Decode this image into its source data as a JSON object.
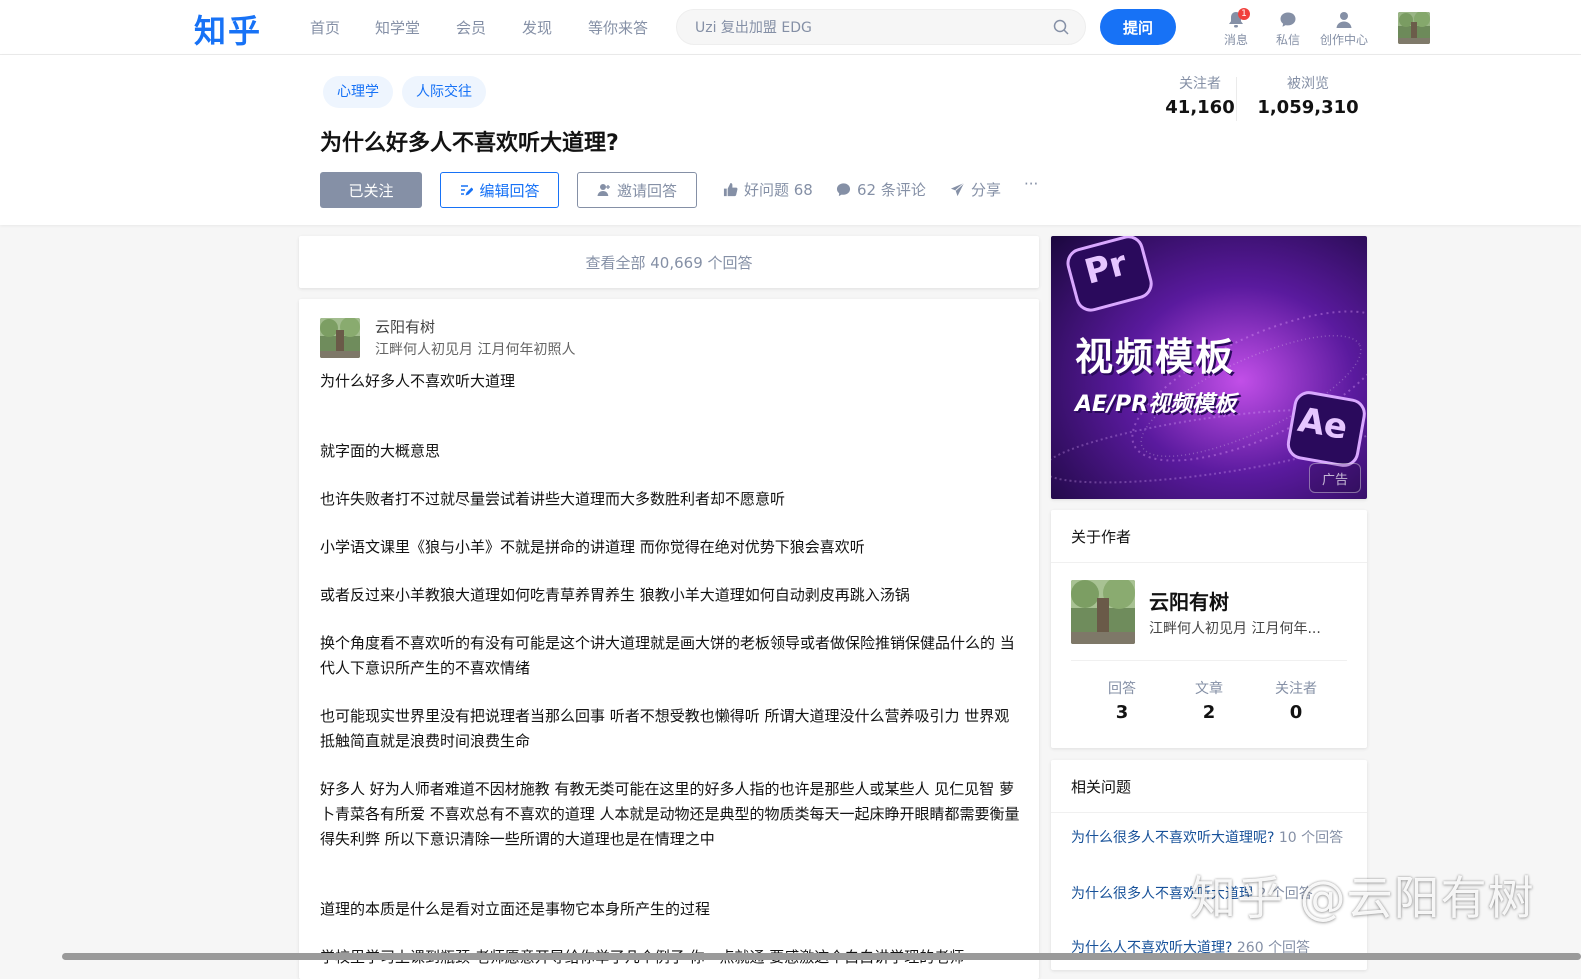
{
  "topbar": {
    "logo": "知乎",
    "nav": [
      "首页",
      "知学堂",
      "会员",
      "发现",
      "等你来答"
    ],
    "search_placeholder": "Uzi 复出加盟 EDG",
    "ask_label": "提问",
    "icons": [
      {
        "label": "消息",
        "icon": "bell-icon",
        "badge": "1"
      },
      {
        "label": "私信",
        "icon": "chat-icon"
      },
      {
        "label": "创作中心",
        "icon": "creator-icon"
      }
    ]
  },
  "question": {
    "tags": [
      "心理学",
      "人际交往"
    ],
    "title": "为什么好多人不喜欢听大道理?",
    "followed_label": "已关注",
    "edit_label": "编辑回答",
    "invite_label": "邀请回答",
    "good_question": "好问题 68",
    "comments": "62 条评论",
    "share": "分享",
    "more": "···",
    "followers_label": "关注者",
    "followers": "41,160",
    "views_label": "被浏览",
    "views": "1,059,310"
  },
  "view_all": "查看全部 40,669 个回答",
  "answer": {
    "author_name": "云阳有树",
    "author_bio": "江畔何人初见月 江月何年初照人",
    "paragraphs": [
      "为什么好多人不喜欢听大道理",
      "就字面的大概意思",
      "也许失败者打不过就尽量尝试着讲些大道理而大多数胜利者却不愿意听",
      "小学语文课里《狼与小羊》不就是拼命的讲道理 而你觉得在绝对优势下狼会喜欢听",
      "或者反过来小羊教狼大道理如何吃青草养胃养生 狼教小羊大道理如何自动剥皮再跳入汤锅",
      "换个角度看不喜欢听的有没有可能是这个讲大道理就是画大饼的老板领导或者做保险推销保健品什么的 当代人下意识所产生的不喜欢情绪",
      "也可能现实世界里没有把说理者当那么回事 听者不想受教也懒得听 所谓大道理没什么营养吸引力 世界观抵触简直就是浪费时间浪费生命",
      "好多人 好为人师者难道不因材施教 有教无类可能在这里的好多人指的也许是那些人或某些人 见仁见智 萝卜青菜各有所爱 不喜欢总有不喜欢的道理 人本就是动物还是典型的物质类每天一起床睁开眼睛都需要衡量得失利弊 所以下意识清除一些所谓的大道理也是在情理之中",
      "道理的本质是什么是看对立面还是事物它本身所产生的过程",
      "学校里学习上课到瓶颈 老师愿意开导给你举了几个例子 你一点就通 要感激这个白白讲学理的老师"
    ]
  },
  "ad": {
    "title": "视频模板",
    "subtitle": "AE/PR视频模板",
    "pr_text": "Pr",
    "ae_text": "Ae",
    "badge": "广告"
  },
  "author_card": {
    "header": "关于作者",
    "name": "云阳有树",
    "bio": "江畔何人初见月 江月何年...",
    "stats": [
      {
        "label": "回答",
        "value": "3"
      },
      {
        "label": "文章",
        "value": "2"
      },
      {
        "label": "关注者",
        "value": "0"
      }
    ]
  },
  "related": {
    "header": "相关问题",
    "items": [
      {
        "title": "为什么很多人不喜欢听大道理呢?",
        "count": "10 个回答"
      },
      {
        "title": "为什么很多人不喜欢听大道理",
        "count": "2 个回答"
      },
      {
        "title": "为什么人不喜欢听大道理?",
        "count": "260 个回答"
      }
    ]
  },
  "watermark": "知乎 @云阳有树",
  "colors": {
    "brand": "#1772f6",
    "muted": "#8590a6",
    "link": "#175199",
    "ad_purple": "#6a1fb5"
  }
}
